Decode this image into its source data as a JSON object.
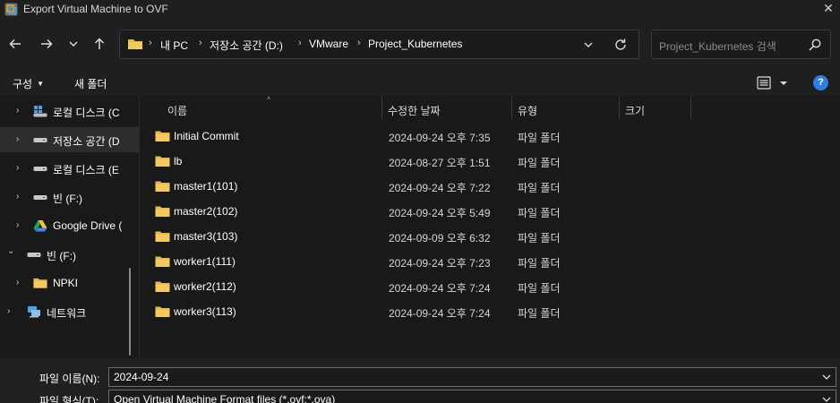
{
  "window": {
    "title": "Export Virtual Machine to OVF",
    "close_glyph": "✕"
  },
  "nav": {
    "back_icon": "arrow-left-icon",
    "forward_icon": "arrow-right-icon",
    "recent_icon": "chevron-down-icon",
    "up_icon": "arrow-up-icon"
  },
  "address": {
    "breadcrumbs": [
      "내 PC",
      "저장소 공간 (D:)",
      "VMware",
      "Project_Kubernetes"
    ],
    "separator": "›"
  },
  "search": {
    "placeholder": "Project_Kubernetes 검색"
  },
  "commandbar": {
    "organize": "구성",
    "new_folder": "새 폴더",
    "help": "?"
  },
  "sidebar": {
    "items": [
      {
        "label": "로컬 디스크 (C",
        "icon": "drive-windows-icon",
        "chevron": "›",
        "selected": false
      },
      {
        "label": "저장소 공간 (D",
        "icon": "drive-icon",
        "chevron": "›",
        "selected": true
      },
      {
        "label": "로컬 디스크 (E",
        "icon": "drive-icon",
        "chevron": "›",
        "selected": false
      },
      {
        "label": "빈 (F:)",
        "icon": "drive-icon",
        "chevron": "›",
        "selected": false
      },
      {
        "label": "Google Drive (",
        "icon": "google-drive-icon",
        "chevron": "›",
        "selected": false
      },
      {
        "label": "빈 (F:)",
        "icon": "drive-icon",
        "chevron": "⌄",
        "selected": false
      },
      {
        "label": "NPKI",
        "icon": "folder-icon",
        "chevron": "›",
        "selected": false
      },
      {
        "label": "네트워크",
        "icon": "network-icon",
        "chevron": "›",
        "selected": false
      }
    ]
  },
  "filelist": {
    "columns": {
      "name": "이름",
      "modified": "수정한 날짜",
      "type": "유형",
      "size": "크기"
    },
    "sort_indicator": "^",
    "rows": [
      {
        "name": "Initial Commit",
        "modified": "2024-09-24 오후 7:35",
        "type": "파일 폴더"
      },
      {
        "name": "lb",
        "modified": "2024-08-27 오후 1:51",
        "type": "파일 폴더"
      },
      {
        "name": "master1(101)",
        "modified": "2024-09-24 오후 7:22",
        "type": "파일 폴더"
      },
      {
        "name": "master2(102)",
        "modified": "2024-09-24 오후 5:49",
        "type": "파일 폴더"
      },
      {
        "name": "master3(103)",
        "modified": "2024-09-09 오후 6:32",
        "type": "파일 폴더"
      },
      {
        "name": "worker1(111)",
        "modified": "2024-09-24 오후 7:23",
        "type": "파일 폴더"
      },
      {
        "name": "worker2(112)",
        "modified": "2024-09-24 오후 7:24",
        "type": "파일 폴더"
      },
      {
        "name": "worker3(113)",
        "modified": "2024-09-24 오후 7:24",
        "type": "파일 폴더"
      }
    ]
  },
  "bottom": {
    "filename_label": "파일 이름(N):",
    "filename_value": "2024-09-24",
    "filetype_label": "파일 형식(T):",
    "filetype_value": "Open Virtual Machine Format files (*.ovf;*.ova)"
  },
  "colors": {
    "folder": "#e8b84a",
    "accent": "#2f7de1",
    "background": "#191919"
  }
}
